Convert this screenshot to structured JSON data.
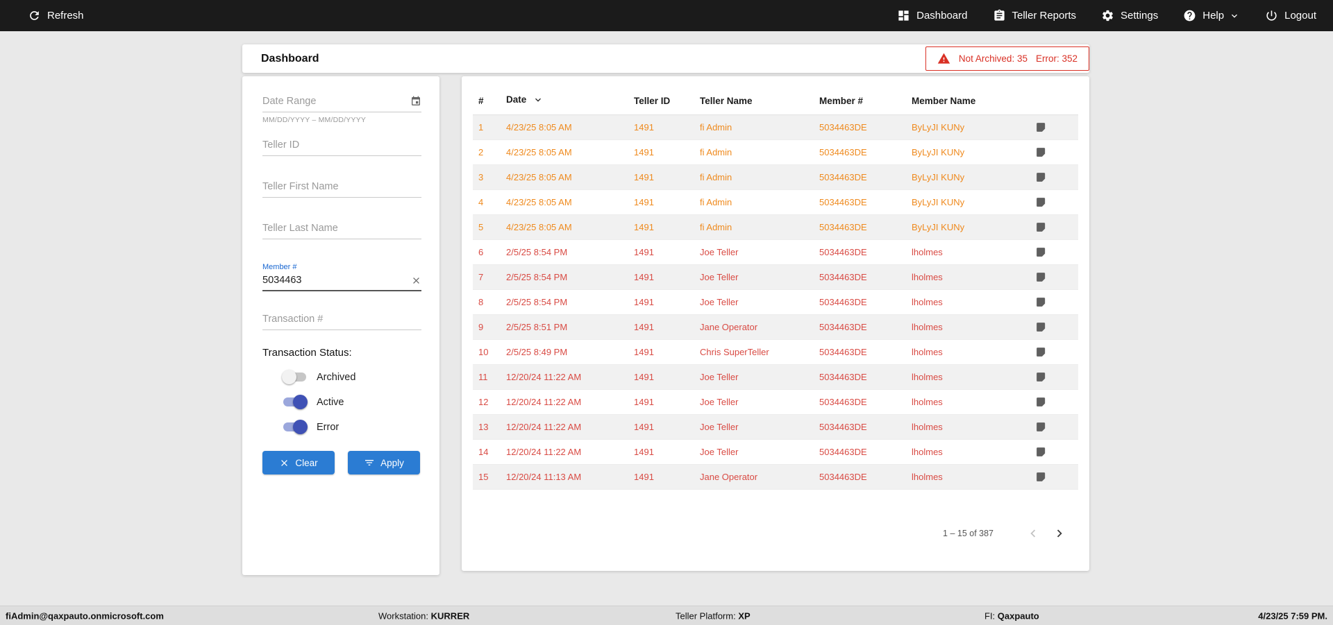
{
  "topbar": {
    "refresh_label": "Refresh",
    "nav": [
      {
        "label": "Dashboard"
      },
      {
        "label": "Teller Reports"
      },
      {
        "label": "Settings"
      },
      {
        "label": "Help"
      },
      {
        "label": "Logout"
      }
    ]
  },
  "header": {
    "title": "Dashboard",
    "alert": {
      "not_archived": "Not Archived: 35",
      "error": "Error: 352"
    }
  },
  "filters": {
    "date_range": {
      "placeholder": "Date Range",
      "helper": "MM/DD/YYYY – MM/DD/YYYY"
    },
    "teller_id_placeholder": "Teller ID",
    "teller_first_name_placeholder": "Teller First Name",
    "teller_last_name_placeholder": "Teller Last Name",
    "member_number": {
      "label": "Member #",
      "value": "5034463"
    },
    "transaction_placeholder": "Transaction #",
    "status_label": "Transaction Status:",
    "toggles": [
      {
        "label": "Archived",
        "on": false
      },
      {
        "label": "Active",
        "on": true
      },
      {
        "label": "Error",
        "on": true
      }
    ],
    "clear_label": "Clear",
    "apply_label": "Apply"
  },
  "table": {
    "columns": {
      "num": "#",
      "date": "Date",
      "teller_id": "Teller ID",
      "teller_name": "Teller Name",
      "member": "Member #",
      "member_name": "Member Name"
    },
    "rows": [
      {
        "num": "1",
        "date": "4/23/25 8:05 AM",
        "teller_id": "1491",
        "teller_name": "fi Admin",
        "member": "5034463DE",
        "member_name": "ByLyJI KUNy",
        "color": "orange"
      },
      {
        "num": "2",
        "date": "4/23/25 8:05 AM",
        "teller_id": "1491",
        "teller_name": "fi Admin",
        "member": "5034463DE",
        "member_name": "ByLyJI KUNy",
        "color": "orange"
      },
      {
        "num": "3",
        "date": "4/23/25 8:05 AM",
        "teller_id": "1491",
        "teller_name": "fi Admin",
        "member": "5034463DE",
        "member_name": "ByLyJI KUNy",
        "color": "orange"
      },
      {
        "num": "4",
        "date": "4/23/25 8:05 AM",
        "teller_id": "1491",
        "teller_name": "fi Admin",
        "member": "5034463DE",
        "member_name": "ByLyJI KUNy",
        "color": "orange"
      },
      {
        "num": "5",
        "date": "4/23/25 8:05 AM",
        "teller_id": "1491",
        "teller_name": "fi Admin",
        "member": "5034463DE",
        "member_name": "ByLyJI KUNy",
        "color": "orange"
      },
      {
        "num": "6",
        "date": "2/5/25 8:54 PM",
        "teller_id": "1491",
        "teller_name": "Joe Teller",
        "member": "5034463DE",
        "member_name": "lholmes",
        "color": "red"
      },
      {
        "num": "7",
        "date": "2/5/25 8:54 PM",
        "teller_id": "1491",
        "teller_name": "Joe Teller",
        "member": "5034463DE",
        "member_name": "lholmes",
        "color": "red"
      },
      {
        "num": "8",
        "date": "2/5/25 8:54 PM",
        "teller_id": "1491",
        "teller_name": "Joe Teller",
        "member": "5034463DE",
        "member_name": "lholmes",
        "color": "red"
      },
      {
        "num": "9",
        "date": "2/5/25 8:51 PM",
        "teller_id": "1491",
        "teller_name": "Jane Operator",
        "member": "5034463DE",
        "member_name": "lholmes",
        "color": "red"
      },
      {
        "num": "10",
        "date": "2/5/25 8:49 PM",
        "teller_id": "1491",
        "teller_name": "Chris SuperTeller",
        "member": "5034463DE",
        "member_name": "lholmes",
        "color": "red"
      },
      {
        "num": "11",
        "date": "12/20/24 11:22 AM",
        "teller_id": "1491",
        "teller_name": "Joe Teller",
        "member": "5034463DE",
        "member_name": "lholmes",
        "color": "red"
      },
      {
        "num": "12",
        "date": "12/20/24 11:22 AM",
        "teller_id": "1491",
        "teller_name": "Joe Teller",
        "member": "5034463DE",
        "member_name": "lholmes",
        "color": "red"
      },
      {
        "num": "13",
        "date": "12/20/24 11:22 AM",
        "teller_id": "1491",
        "teller_name": "Joe Teller",
        "member": "5034463DE",
        "member_name": "lholmes",
        "color": "red"
      },
      {
        "num": "14",
        "date": "12/20/24 11:22 AM",
        "teller_id": "1491",
        "teller_name": "Joe Teller",
        "member": "5034463DE",
        "member_name": "lholmes",
        "color": "red"
      },
      {
        "num": "15",
        "date": "12/20/24 11:13 AM",
        "teller_id": "1491",
        "teller_name": "Jane Operator",
        "member": "5034463DE",
        "member_name": "lholmes",
        "color": "red"
      }
    ],
    "pagination": {
      "range": "1 – 15 of 387"
    }
  },
  "footer": {
    "email": "fiAdmin@qaxpauto.onmicrosoft.com",
    "workstation_label": "Workstation:",
    "workstation_value": "KURRER",
    "platform_label": "Teller Platform:",
    "platform_value": "XP",
    "fi_label": "FI:",
    "fi_value": "Qaxpauto",
    "datetime": "4/23/25 7:59 PM."
  },
  "colors": {
    "orange": "#EF8A1E",
    "red": "#D94B44",
    "accent_blue": "#2B7CD3",
    "alert_red": "#D93025",
    "toggle_on": "#3F51B5"
  }
}
